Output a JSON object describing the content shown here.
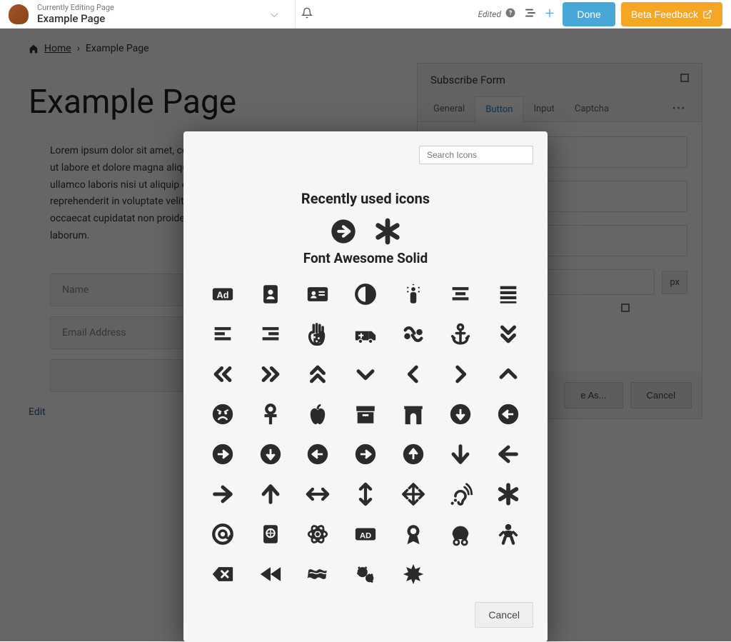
{
  "topbar": {
    "editing_label": "Currently Editing Page",
    "page_title": "Example Page",
    "edited_label": "Edited",
    "done": "Done",
    "beta": "Beta Feedback"
  },
  "breadcrumb": {
    "home": "Home",
    "current": "Example Page"
  },
  "page": {
    "heading": "Example Page",
    "lorem": "Lorem ipsum dolor sit amet, consectetur adipiscing elit, sed do eiusmod tempor incididunt ut labore et dolore magna aliqua. Ut enim ad minim veniam, quis nostrud exercitation ullamco laboris nisi ut aliquip ex ea commodo consequat. Duis aute irure dolor in reprehenderit in voluptate velit esse cillum dolore eu fugiat nulla pariatur. Excepteur sint occaecat cupidatat non proident, sunt in culpa qui officia deserunt mollit anim id est laborum.",
    "name_ph": "Name",
    "email_ph": "Email Address",
    "edit": "Edit"
  },
  "panel": {
    "title": "Subscribe Form",
    "tabs": {
      "general": "General",
      "button": "Button",
      "input": "Input",
      "captcha": "Captcha"
    },
    "unit": "px",
    "save_as": "e As...",
    "cancel": "Cancel"
  },
  "modal": {
    "search_ph": "Search Icons",
    "recent_h": "Recently used icons",
    "fa_h": "Font Awesome Solid",
    "cancel": "Cancel",
    "recent_icons": [
      "arrow-circle-right",
      "asterisk"
    ],
    "grid_icons": [
      "ad",
      "address-book",
      "address-card",
      "adjust",
      "air-freshener",
      "align-center",
      "align-justify",
      "align-left",
      "align-right",
      "allergies",
      "ambulance",
      "asl-interpreting",
      "anchor",
      "angle-double-down",
      "angle-double-left",
      "angle-double-right",
      "angle-double-up",
      "angle-down",
      "angle-left",
      "angle-right",
      "angle-up",
      "angry",
      "ankh",
      "apple-alt",
      "archive",
      "archway",
      "arrow-alt-circle-down",
      "arrow-alt-circle-left",
      "arrow-alt-circle-right",
      "arrow-alt-circle-down-2",
      "arrow-alt-circle-left-2",
      "arrow-alt-circle-right-2",
      "arrow-alt-circle-up",
      "arrow-down",
      "arrow-left",
      "arrow-right",
      "arrow-up",
      "arrows-alt-h",
      "arrows-alt-v",
      "arrows-alt",
      "assistive-listening",
      "asterisk",
      "at",
      "atlas",
      "atom",
      "audio-description",
      "award",
      "baby-carriage",
      "baby",
      "backspace",
      "backward",
      "bacon",
      "bacteria",
      "bahai"
    ]
  }
}
